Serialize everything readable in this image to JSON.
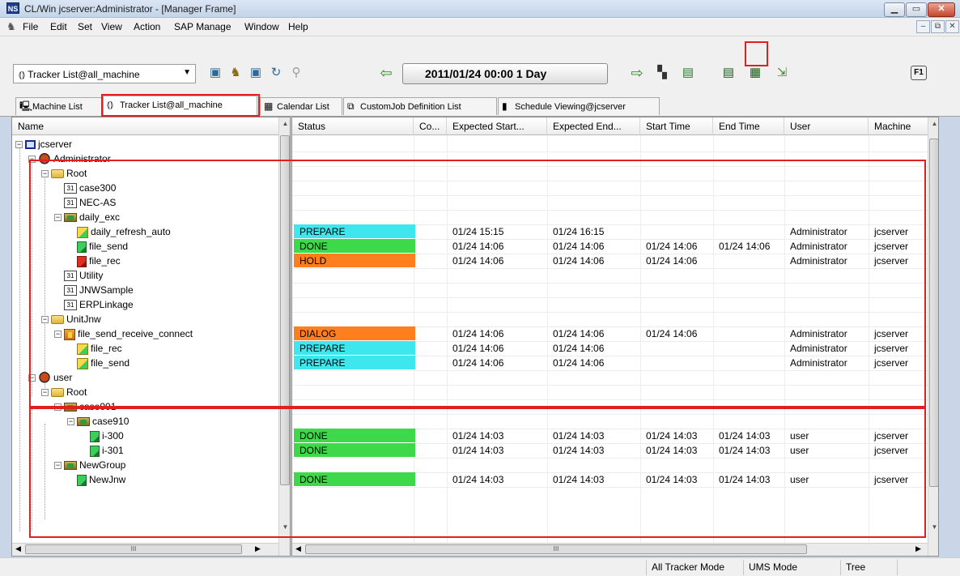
{
  "window": {
    "icon_text": "NS",
    "title": "CL/Win jcserver:Administrator - [Manager Frame]",
    "minimize": "▁",
    "restore": "▭",
    "close": "✕"
  },
  "menu": {
    "items": [
      "File",
      "Edit",
      "Set",
      "View",
      "Action",
      "SAP Manage",
      "Window",
      "Help"
    ],
    "mdi_min": "–",
    "mdi_restore": "⧉",
    "mdi_close": "✕"
  },
  "toolbar": {
    "combo_value": "⦅⦆ Tracker List@all_machine",
    "combo_arrow": "▼",
    "date_range": "2011/01/24 00:00   1 Day",
    "back_arrow": "⇦",
    "forward_arrow": "⇨",
    "f1_label": "F1"
  },
  "tabs": [
    {
      "icon": "🖳",
      "label": "Machine List"
    },
    {
      "icon": "⦅⦆",
      "label": "Tracker List@all_machine"
    },
    {
      "icon": "▦",
      "label": "Calendar List"
    },
    {
      "icon": "⧉",
      "label": "CustomJob Definition List"
    },
    {
      "icon": "▮",
      "label": "Schedule Viewing@jcserver"
    }
  ],
  "tree": {
    "header": "Name",
    "hscroll_thumb": "III"
  },
  "tree_rows": [
    {
      "label": "jcserver",
      "icon": "server",
      "exp": "−"
    },
    {
      "label": "Administrator",
      "icon": "user",
      "exp": "−"
    },
    {
      "label": "Root",
      "icon": "folder",
      "exp": "−"
    },
    {
      "label": "case300",
      "icon": "cal",
      "exp": ""
    },
    {
      "label": "NEC-AS",
      "icon": "cal",
      "exp": ""
    },
    {
      "label": "daily_exc",
      "icon": "group",
      "exp": "−"
    },
    {
      "label": "daily_refresh_auto",
      "icon": "jobw",
      "exp": ""
    },
    {
      "label": "file_send",
      "icon": "jobp",
      "exp": ""
    },
    {
      "label": "file_rec",
      "icon": "jobh",
      "exp": ""
    },
    {
      "label": "Utility",
      "icon": "cal",
      "exp": ""
    },
    {
      "label": "JNWSample",
      "icon": "cal",
      "exp": ""
    },
    {
      "label": "ERPLinkage",
      "icon": "cal",
      "exp": ""
    },
    {
      "label": "UnitJnw",
      "icon": "folder",
      "exp": "−"
    },
    {
      "label": "file_send_receive_connect",
      "icon": "jobn",
      "exp": "−"
    },
    {
      "label": "file_rec",
      "icon": "jobw",
      "exp": ""
    },
    {
      "label": "file_send",
      "icon": "jobw",
      "exp": ""
    },
    {
      "label": "user",
      "icon": "user",
      "exp": "−"
    },
    {
      "label": "Root",
      "icon": "folder",
      "exp": "−"
    },
    {
      "label": "case001",
      "icon": "group",
      "exp": "−"
    },
    {
      "label": "case910",
      "icon": "group",
      "exp": "−"
    },
    {
      "label": "i-300",
      "icon": "jobp",
      "exp": ""
    },
    {
      "label": "i-301",
      "icon": "jobp",
      "exp": ""
    },
    {
      "label": "NewGroup",
      "icon": "group",
      "exp": "−"
    },
    {
      "label": "NewJnw",
      "icon": "jobp",
      "exp": ""
    }
  ],
  "grid": {
    "columns": [
      "Status",
      "Co...",
      "Expected Start...",
      "Expected End...",
      "Start Time",
      "End Time",
      "User",
      "Machine"
    ],
    "hscroll_thumb": "III",
    "status_colors": {
      "PREPARE": "#3ee6ee",
      "DONE": "#3dd94a",
      "HOLD": "#ff7f1e",
      "DIALOG": "#ff7f1e"
    },
    "rows": [
      {
        "status": "",
        "co": "",
        "exp_start": "",
        "exp_end": "",
        "start": "",
        "end": "",
        "user": "",
        "machine": ""
      },
      {
        "status": "",
        "co": "",
        "exp_start": "",
        "exp_end": "",
        "start": "",
        "end": "",
        "user": "",
        "machine": ""
      },
      {
        "status": "",
        "co": "",
        "exp_start": "",
        "exp_end": "",
        "start": "",
        "end": "",
        "user": "",
        "machine": ""
      },
      {
        "status": "",
        "co": "",
        "exp_start": "",
        "exp_end": "",
        "start": "",
        "end": "",
        "user": "",
        "machine": ""
      },
      {
        "status": "",
        "co": "",
        "exp_start": "",
        "exp_end": "",
        "start": "",
        "end": "",
        "user": "",
        "machine": ""
      },
      {
        "status": "",
        "co": "",
        "exp_start": "",
        "exp_end": "",
        "start": "",
        "end": "",
        "user": "",
        "machine": ""
      },
      {
        "status": "PREPARE",
        "co": "",
        "exp_start": "01/24 15:15",
        "exp_end": "01/24 16:15",
        "start": "",
        "end": "",
        "user": "Administrator",
        "machine": "jcserver"
      },
      {
        "status": "DONE",
        "co": "",
        "exp_start": "01/24 14:06",
        "exp_end": "01/24 14:06",
        "start": "01/24 14:06",
        "end": "01/24 14:06",
        "user": "Administrator",
        "machine": "jcserver"
      },
      {
        "status": "HOLD",
        "co": "",
        "exp_start": "01/24 14:06",
        "exp_end": "01/24 14:06",
        "start": "01/24 14:06",
        "end": "",
        "user": "Administrator",
        "machine": "jcserver"
      },
      {
        "status": "",
        "co": "",
        "exp_start": "",
        "exp_end": "",
        "start": "",
        "end": "",
        "user": "",
        "machine": ""
      },
      {
        "status": "",
        "co": "",
        "exp_start": "",
        "exp_end": "",
        "start": "",
        "end": "",
        "user": "",
        "machine": ""
      },
      {
        "status": "",
        "co": "",
        "exp_start": "",
        "exp_end": "",
        "start": "",
        "end": "",
        "user": "",
        "machine": ""
      },
      {
        "status": "",
        "co": "",
        "exp_start": "",
        "exp_end": "",
        "start": "",
        "end": "",
        "user": "",
        "machine": ""
      },
      {
        "status": "DIALOG",
        "co": "",
        "exp_start": "01/24 14:06",
        "exp_end": "01/24 14:06",
        "start": "01/24 14:06",
        "end": "",
        "user": "Administrator",
        "machine": "jcserver"
      },
      {
        "status": "PREPARE",
        "co": "",
        "exp_start": "01/24 14:06",
        "exp_end": "01/24 14:06",
        "start": "",
        "end": "",
        "user": "Administrator",
        "machine": "jcserver"
      },
      {
        "status": "PREPARE",
        "co": "",
        "exp_start": "01/24 14:06",
        "exp_end": "01/24 14:06",
        "start": "",
        "end": "",
        "user": "Administrator",
        "machine": "jcserver"
      },
      {
        "status": "",
        "co": "",
        "exp_start": "",
        "exp_end": "",
        "start": "",
        "end": "",
        "user": "",
        "machine": ""
      },
      {
        "status": "",
        "co": "",
        "exp_start": "",
        "exp_end": "",
        "start": "",
        "end": "",
        "user": "",
        "machine": ""
      },
      {
        "status": "",
        "co": "",
        "exp_start": "",
        "exp_end": "",
        "start": "",
        "end": "",
        "user": "",
        "machine": ""
      },
      {
        "status": "",
        "co": "",
        "exp_start": "",
        "exp_end": "",
        "start": "",
        "end": "",
        "user": "",
        "machine": ""
      },
      {
        "status": "DONE",
        "co": "",
        "exp_start": "01/24 14:03",
        "exp_end": "01/24 14:03",
        "start": "01/24 14:03",
        "end": "01/24 14:03",
        "user": "user",
        "machine": "jcserver"
      },
      {
        "status": "DONE",
        "co": "",
        "exp_start": "01/24 14:03",
        "exp_end": "01/24 14:03",
        "start": "01/24 14:03",
        "end": "01/24 14:03",
        "user": "user",
        "machine": "jcserver"
      },
      {
        "status": "",
        "co": "",
        "exp_start": "",
        "exp_end": "",
        "start": "",
        "end": "",
        "user": "",
        "machine": ""
      },
      {
        "status": "DONE",
        "co": "",
        "exp_start": "01/24 14:03",
        "exp_end": "01/24 14:03",
        "start": "01/24 14:03",
        "end": "01/24 14:03",
        "user": "user",
        "machine": "jcserver"
      }
    ]
  },
  "status_bar": {
    "mode1": "All Tracker Mode",
    "mode2": "UMS Mode",
    "view": "Tree"
  }
}
